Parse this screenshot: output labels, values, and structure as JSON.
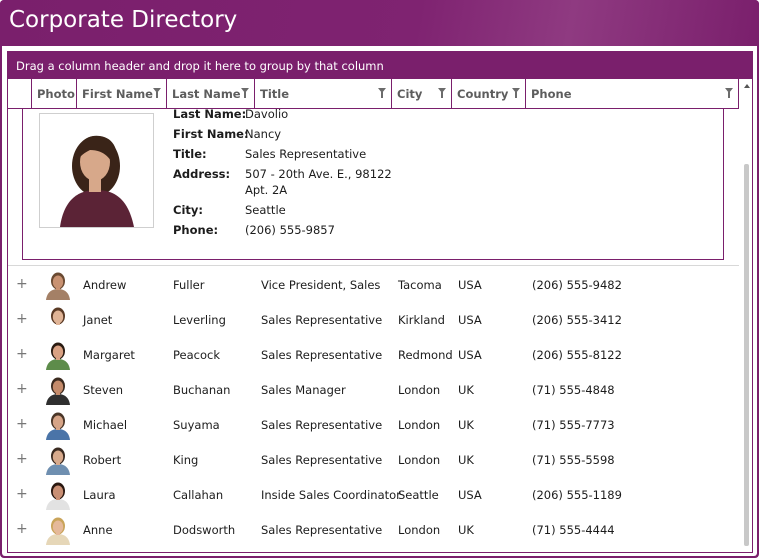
{
  "app": {
    "title": "Corporate Directory"
  },
  "group_panel": {
    "text": "Drag a column header and drop it here to group by that column"
  },
  "columns": [
    "Photo",
    "First Name",
    "Last Name",
    "Title",
    "City",
    "Country",
    "Phone"
  ],
  "details": {
    "rows": [
      {
        "label": "Last Name:",
        "value": "Davolio"
      },
      {
        "label": "First Name:",
        "value": "Nancy"
      },
      {
        "label": "Title:",
        "value": "Sales Representative"
      },
      {
        "label": "Address:",
        "value": "507 - 20th Ave. E., 98122",
        "value2": "Apt. 2A"
      },
      {
        "label": "City:",
        "value": "Seattle"
      },
      {
        "label": "Phone:",
        "value": "(206) 555-9857"
      }
    ]
  },
  "employees": [
    {
      "first": "Andrew",
      "last": "Fuller",
      "title": "Vice President, Sales",
      "city": "Tacoma",
      "country": "USA",
      "phone": "(206) 555-9482"
    },
    {
      "first": "Janet",
      "last": "Leverling",
      "title": "Sales Representative",
      "city": "Kirkland",
      "country": "USA",
      "phone": "(206) 555-3412"
    },
    {
      "first": "Margaret",
      "last": "Peacock",
      "title": "Sales Representative",
      "city": "Redmond",
      "country": "USA",
      "phone": "(206) 555-8122"
    },
    {
      "first": "Steven",
      "last": "Buchanan",
      "title": "Sales Manager",
      "city": "London",
      "country": "UK",
      "phone": "(71) 555-4848"
    },
    {
      "first": "Michael",
      "last": "Suyama",
      "title": "Sales Representative",
      "city": "London",
      "country": "UK",
      "phone": "(71) 555-7773"
    },
    {
      "first": "Robert",
      "last": "King",
      "title": "Sales Representative",
      "city": "London",
      "country": "UK",
      "phone": "(71) 555-5598"
    },
    {
      "first": "Laura",
      "last": "Callahan",
      "title": "Inside Sales Coordinator",
      "city": "Seattle",
      "country": "USA",
      "phone": "(206) 555-1189"
    },
    {
      "first": "Anne",
      "last": "Dodsworth",
      "title": "Sales Representative",
      "city": "London",
      "country": "UK",
      "phone": "(71) 555-4444"
    }
  ],
  "icons": {
    "expand": "+",
    "filter": "filter-icon"
  },
  "colors": {
    "accent": "#7a1f6c",
    "header_text": "#5d5d5d"
  }
}
